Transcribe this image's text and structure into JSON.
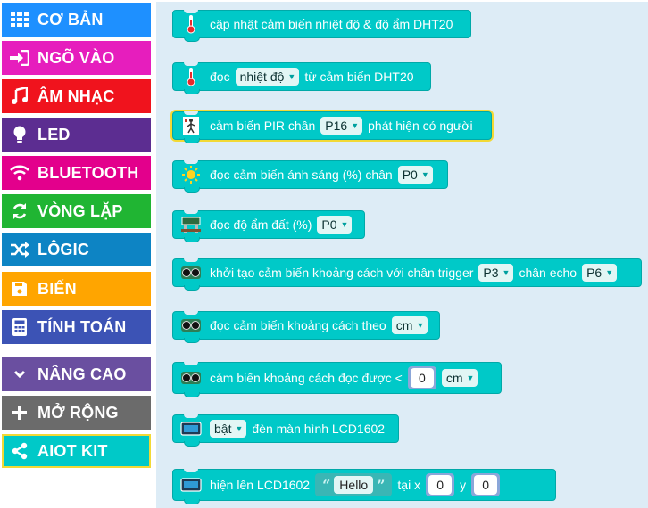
{
  "sidebar": {
    "items": [
      {
        "label": "CƠ BẢN",
        "icon": "grid-icon",
        "color": "#1e90ff"
      },
      {
        "label": "NGÕ VÀO",
        "icon": "sign-in-icon",
        "color": "#e61ebd"
      },
      {
        "label": "ÂM NHẠC",
        "icon": "music-note-icon",
        "color": "#f0131d"
      },
      {
        "label": "LED",
        "icon": "lightbulb-icon",
        "color": "#5c2d91"
      },
      {
        "label": "BLUETOOTH",
        "icon": "wifi-icon",
        "color": "#e3008c"
      },
      {
        "label": "VÒNG LẶP",
        "icon": "refresh-icon",
        "color": "#20b533"
      },
      {
        "label": "LÔGIC",
        "icon": "shuffle-icon",
        "color": "#0d84c4"
      },
      {
        "label": "BIẾN",
        "icon": "floppy-disk-icon",
        "color": "#ffa500"
      },
      {
        "label": "TÍNH TOÁN",
        "icon": "calculator-icon",
        "color": "#3c53b5"
      },
      {
        "label": "NÂNG CAO",
        "icon": "chevron-down-icon",
        "color": "#6a4fa0"
      },
      {
        "label": "MỞ RỘNG",
        "icon": "plus-icon",
        "color": "#6b6b6b"
      },
      {
        "label": "AIOT KIT",
        "icon": "share-icon",
        "color": "#00c9c8"
      }
    ],
    "selected": "AIOT KIT"
  },
  "flyout": {
    "block_color": "#00c9c8",
    "blocks": {
      "dht_update": {
        "text": "cập nhật cảm biến nhiệt độ & độ ẩm DHT20",
        "icon": "thermometer-icon"
      },
      "dht_read": {
        "pre": "đọc",
        "dropdown": "nhiệt độ",
        "post": "từ cảm biến DHT20",
        "icon": "thermometer-icon"
      },
      "pir": {
        "pre": "cảm biến PIR chân",
        "pin": "P16",
        "post": "phát hiện có người",
        "icon": "pir-sensor-icon"
      },
      "light": {
        "pre": "đọc cảm biến ánh sáng (%) chân",
        "pin": "P0",
        "icon": "sun-icon"
      },
      "soil": {
        "pre": "đọc độ ẩm đất (%)",
        "pin": "P0",
        "icon": "soil-sensor-icon"
      },
      "ultrasonic_init": {
        "pre": "khởi tạo cảm biến khoảng cách với chân trigger",
        "trig": "P3",
        "mid": "chân echo",
        "echo": "P6",
        "icon": "ultrasonic-icon"
      },
      "ultrasonic_read": {
        "pre": "đọc cảm biến khoảng cách theo",
        "unit": "cm",
        "icon": "ultrasonic-icon"
      },
      "ultrasonic_compare": {
        "pre": "cảm biến khoảng cách đọc được <",
        "value": "0",
        "unit": "cm",
        "icon": "ultrasonic-icon"
      },
      "lcd_power": {
        "state": "bật",
        "post": "đèn màn hình LCD1602",
        "icon": "lcd-icon"
      },
      "lcd_show": {
        "pre": "hiện lên LCD1602",
        "string": "Hello",
        "open_quote": "“",
        "close_quote": "”",
        "x_label": "tại x",
        "x": "0",
        "y_label": "y",
        "y": "0",
        "icon": "lcd-icon"
      }
    }
  }
}
